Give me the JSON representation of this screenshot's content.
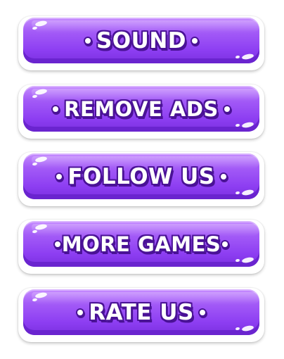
{
  "menu": {
    "buttons": [
      {
        "label": "SOUND"
      },
      {
        "label": "REMOVE ADS"
      },
      {
        "label": "FOLLOW US"
      },
      {
        "label": "MORE GAMES"
      },
      {
        "label": "RATE US"
      }
    ]
  },
  "colors": {
    "button_face": "#9046f2",
    "button_shadow": "#6a24cf",
    "text_outline": "#4a1296",
    "text": "#ffffff"
  }
}
